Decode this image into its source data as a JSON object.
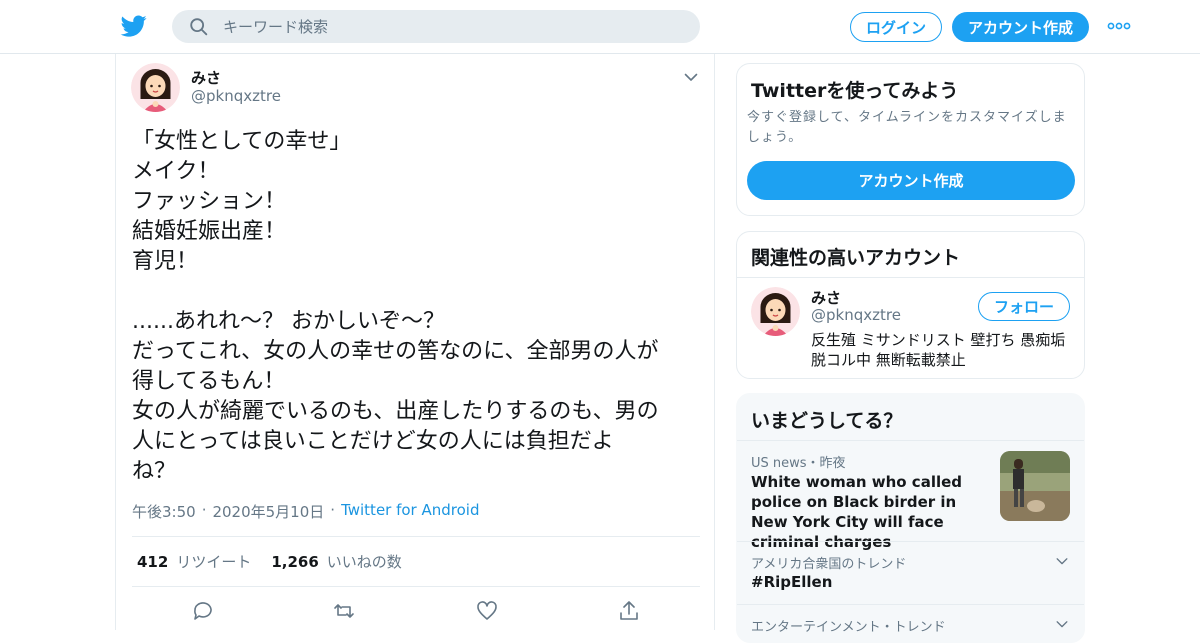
{
  "header": {
    "search_placeholder": "キーワード検索",
    "login_label": "ログイン",
    "signup_label": "アカウント作成",
    "accent": "#1da1f2"
  },
  "tweet": {
    "name": "みさ",
    "handle": "@pknqxztre",
    "text": "「女性としての幸せ」\nメイク！\nファッション！\n結婚妊娠出産！\n育児！\n\n......あれれ〜？ おかしいぞ〜？\nだってこれ、女の人の幸せの筈なのに、全部男の人が\n得してるもん！\n女の人が綺麗でいるのも、出産したりするのも、男の\n人にとっては良いことだけど女の人には負担だよ\nね？",
    "time": "午後3:50",
    "date": "2020年5月10日",
    "source": "Twitter for Android",
    "retweets": "412",
    "retweets_label": "リツイート",
    "likes": "1,266",
    "likes_label": "いいねの数"
  },
  "signup_card": {
    "title": "Twitterを使ってみよう",
    "desc": "今すぐ登録して、タイムラインをカスタマイズしましょう。",
    "button": "アカウント作成"
  },
  "related": {
    "title": "関連性の高いアカウント",
    "name": "みさ",
    "handle": "@pknqxztre",
    "follow": "フォロー",
    "bio": "反生殖 ミサンドリスト 壁打ち 愚痴垢 脱コル中 無断転載禁止"
  },
  "trends": {
    "title": "いまどうしてる？",
    "items": [
      {
        "meta": "US news・昨夜",
        "title": "White woman who called police on Black birder in New York City will face criminal charges"
      },
      {
        "meta": "アメリカ合衆国のトレンド",
        "title": "#RipEllen"
      },
      {
        "meta": "エンターテインメント・トレンド",
        "title": ""
      }
    ]
  }
}
